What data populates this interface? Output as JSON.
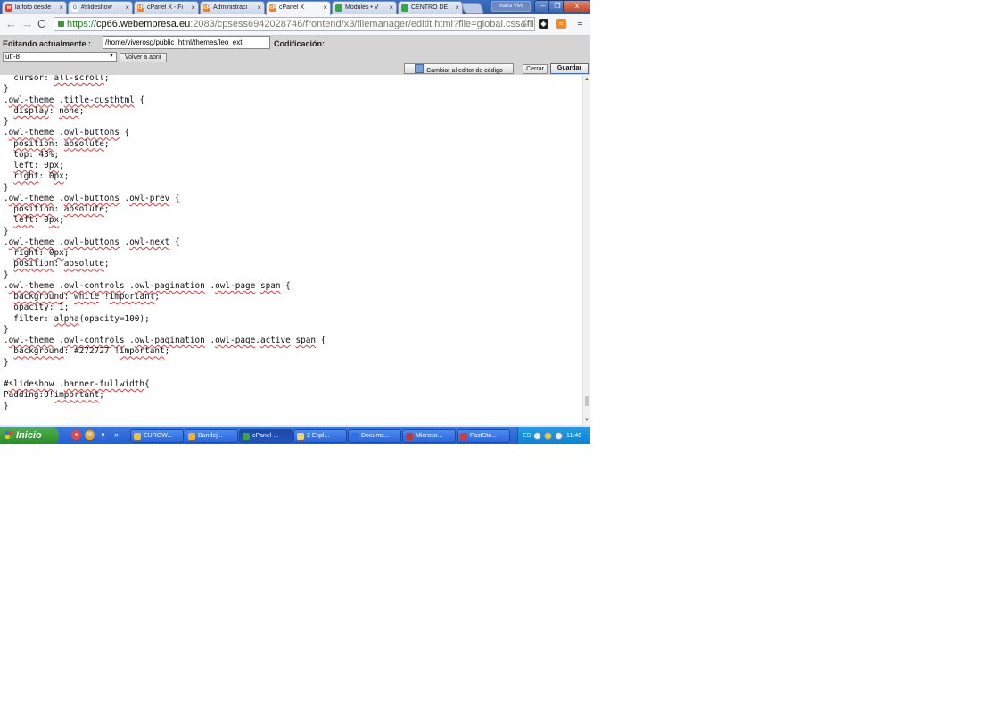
{
  "browser": {
    "tabs": [
      {
        "label": "la foto desde",
        "icon": "wunderlist-favicon-icon",
        "color": "#d7452f",
        "letter": "w"
      },
      {
        "label": "#slideshow",
        "icon": "google-favicon-icon",
        "color": "#ffffff",
        "letter": "G"
      },
      {
        "label": "cPanel X - Fi",
        "icon": "cpanel-favicon-icon",
        "color": "#f0822a",
        "letter": "cP"
      },
      {
        "label": "Administraci",
        "icon": "cpanel-favicon-icon",
        "color": "#f0822a",
        "letter": "cP"
      },
      {
        "label": "cPanel X",
        "icon": "cpanel-favicon-icon",
        "color": "#f0822a",
        "letter": "cP"
      },
      {
        "label": "Modules • V",
        "icon": "plant-favicon-icon",
        "color": "#3aa34a",
        "letter": ""
      },
      {
        "label": "CENTRO DE",
        "icon": "plant-favicon-icon",
        "color": "#3aa34a",
        "letter": ""
      }
    ],
    "active_tab": 4,
    "user_label": "María Vivé",
    "url": {
      "scheme": "https://",
      "host": "cp66.webempresa.eu",
      "path": ":2083/cpsess6942028746/frontend/x3/filemanager/editit.html?file=global.css&file"
    }
  },
  "editor": {
    "editing_label": "Editando actualmente :",
    "path_value": "/home/viverosg/public_html/themes/leo_ext",
    "encoding_label": "Codificación:",
    "encoding_value": "utf-8",
    "reopen_label": "Volver a abrir",
    "switch_editor_label": "Cambiar al editor de código",
    "close_label": "Cerrar",
    "save_label": "Guardar"
  },
  "code_lines": [
    "  cursor: all-scroll;",
    "}",
    ".owl-theme .title-custhtml {",
    "  display: none;",
    "}",
    ".owl-theme .owl-buttons {",
    "  position: absolute;",
    "  top: 43%;",
    "  left: 0px;",
    "  right: 0px;",
    "}",
    ".owl-theme .owl-buttons .owl-prev {",
    "  position: absolute;",
    "  left: 0px;",
    "}",
    ".owl-theme .owl-buttons .owl-next {",
    "  right: 0px;",
    "  position: absolute;",
    "}",
    ".owl-theme .owl-controls .owl-pagination .owl-page span {",
    "  background: white !important;",
    "  opacity: 1;",
    "  filter: alpha(opacity=100);",
    "}",
    ".owl-theme .owl-controls .owl-pagination .owl-page.active span {",
    "  background: #272727 !important;",
    "}",
    "",
    "#slideshow .banner-fullwidth{",
    "Padding:0!important;",
    "}"
  ],
  "taskbar": {
    "start_label": "Inicio",
    "tasks": [
      {
        "label": "EUROW...",
        "color": "#e8c23a"
      },
      {
        "label": "Bandej...",
        "color": "#f0b030"
      },
      {
        "label": "cPanel ...",
        "color": "#3aa34a"
      },
      {
        "label": "2 Expl...",
        "color": "#f2d36a"
      },
      {
        "label": "Docume...",
        "color": "#2f6fe0"
      },
      {
        "label": "Microso...",
        "color": "#c0392b"
      },
      {
        "label": "FastSto...",
        "color": "#d73a3a"
      }
    ],
    "active_task": 2,
    "language": "ES",
    "clock": "11:46"
  }
}
